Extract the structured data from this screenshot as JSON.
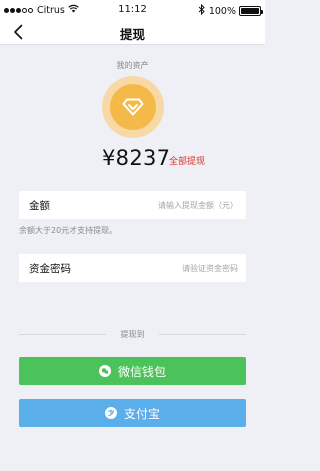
{
  "status_bar": {
    "carrier": "Citrus",
    "time": "11:12",
    "battery": "100%"
  },
  "nav": {
    "title": "提现"
  },
  "assets": {
    "label": "我的资产",
    "balance": "¥8237",
    "withdraw_all": "全部提现"
  },
  "form": {
    "amount_label": "金额",
    "amount_placeholder": "请输入提现金额（元）",
    "hint": "余额大于20元才支持提现。",
    "password_label": "资金密码",
    "password_placeholder": "请验证资金密码"
  },
  "divider": {
    "label": "提现到"
  },
  "buttons": {
    "wechat_label": "微信钱包",
    "alipay_label": "支付宝"
  },
  "colors": {
    "wechat": "#4bc25a",
    "alipay": "#5aaeea",
    "accent_red": "#e0302a",
    "diamond_gold": "#f5b94a"
  }
}
